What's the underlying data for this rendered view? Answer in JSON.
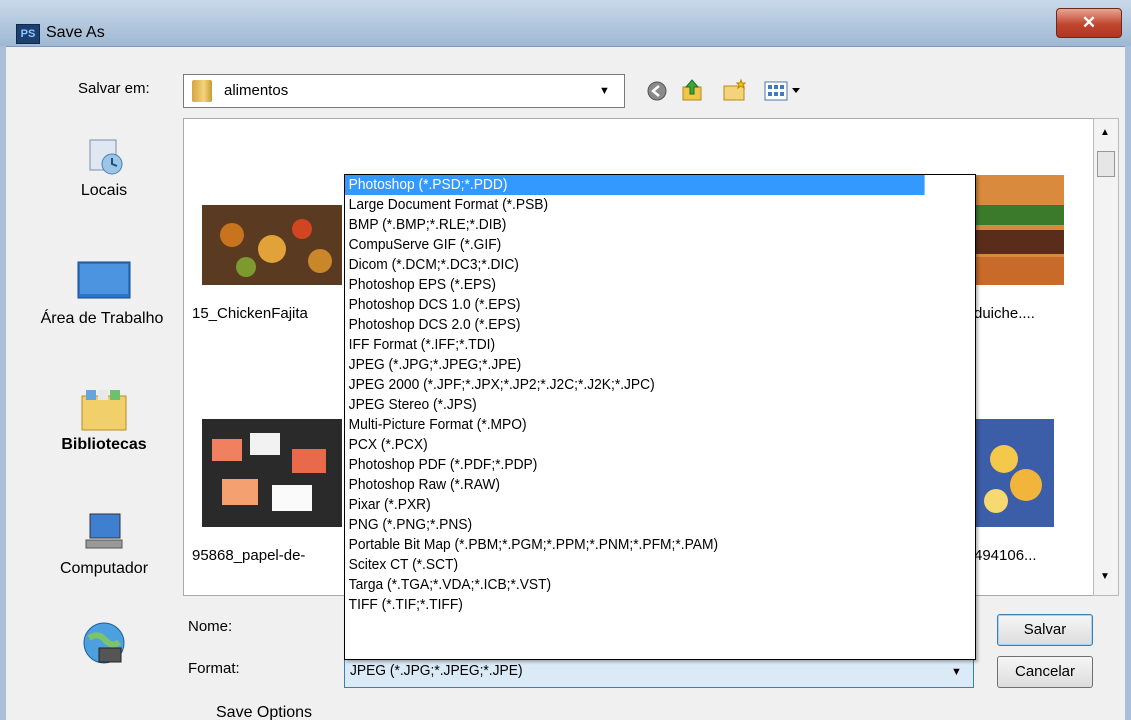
{
  "window": {
    "title": "Save As",
    "app_icon": "PS",
    "close_glyph": "✕"
  },
  "location": {
    "label": "Salvar em:",
    "value": "alimentos"
  },
  "toolbar": {
    "icons": [
      "back-icon",
      "up-folder-icon",
      "new-folder-icon",
      "view-menu-icon"
    ]
  },
  "places": [
    {
      "label": "Locais",
      "icon": "recent-places-icon"
    },
    {
      "label": "Área de Trabalho",
      "icon": "desktop-icon"
    },
    {
      "label": "Bibliotecas",
      "icon": "libraries-icon"
    },
    {
      "label": "Computador",
      "icon": "computer-icon"
    },
    {
      "label": "",
      "icon": "network-icon"
    }
  ],
  "files": [
    {
      "label": "15_ChickenFajita"
    },
    {
      "label": "duiche...."
    },
    {
      "label": "95868_papel-de-"
    },
    {
      "label": "494106..."
    }
  ],
  "formats": [
    "Photoshop (*.PSD;*.PDD)",
    "Large Document Format (*.PSB)",
    "BMP (*.BMP;*.RLE;*.DIB)",
    "CompuServe GIF (*.GIF)",
    "Dicom (*.DCM;*.DC3;*.DIC)",
    "Photoshop EPS (*.EPS)",
    "Photoshop DCS 1.0 (*.EPS)",
    "Photoshop DCS 2.0 (*.EPS)",
    "IFF Format (*.IFF;*.TDI)",
    "JPEG (*.JPG;*.JPEG;*.JPE)",
    "JPEG 2000 (*.JPF;*.JPX;*.JP2;*.J2C;*.J2K;*.JPC)",
    "JPEG Stereo (*.JPS)",
    "Multi-Picture Format (*.MPO)",
    "PCX (*.PCX)",
    "Photoshop PDF (*.PDF;*.PDP)",
    "Photoshop Raw (*.RAW)",
    "Pixar (*.PXR)",
    "PNG (*.PNG;*.PNS)",
    "Portable Bit Map (*.PBM;*.PGM;*.PPM;*.PNM;*.PFM;*.PAM)",
    "Scitex CT (*.SCT)",
    "Targa (*.TGA;*.VDA;*.ICB;*.VST)",
    "TIFF (*.TIF;*.TIFF)"
  ],
  "highlighted_format_index": 0,
  "name_field": {
    "label": "Nome:",
    "value": ""
  },
  "format_field": {
    "label": "Format:",
    "value": "JPEG (*.JPG;*.JPEG;*.JPE)"
  },
  "buttons": {
    "save": "Salvar",
    "cancel": "Cancelar"
  },
  "save_options_label": "Save Options",
  "colors": {
    "selection": "#3399ff",
    "close_button": "#c0462e"
  }
}
